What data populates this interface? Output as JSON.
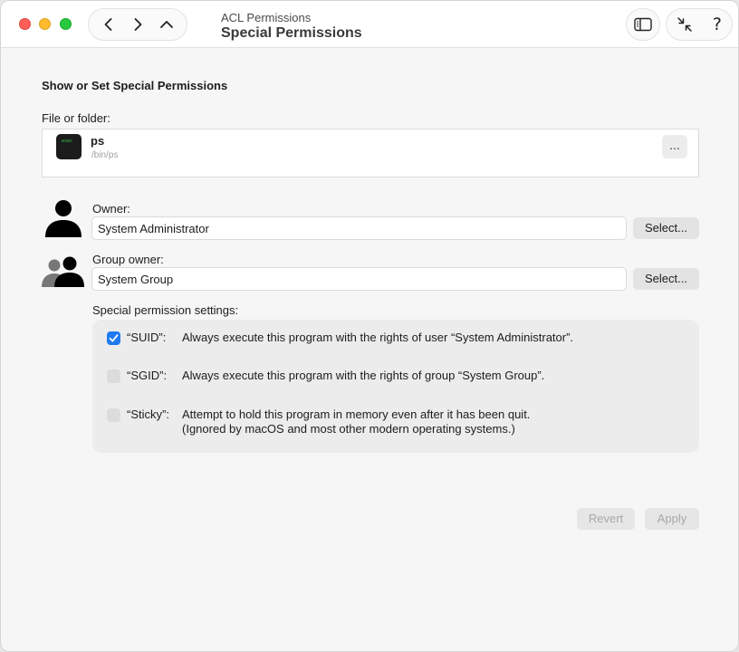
{
  "window": {
    "subtitle": "ACL Permissions",
    "title": "Special Permissions"
  },
  "toolbar": {
    "back_icon": "chevron-left-icon",
    "forward_icon": "chevron-right-icon",
    "up_icon": "chevron-up-icon",
    "sidebar_icon": "sidebar-icon",
    "collapse_icon": "arrows-collapse-icon",
    "help_label": "?"
  },
  "main": {
    "heading": "Show or Set Special Permissions",
    "file_label": "File or folder:",
    "file": {
      "name": "ps",
      "path": "/bin/ps",
      "icon_text": "exec",
      "more_label": "..."
    },
    "owner": {
      "label": "Owner:",
      "value": "System Administrator",
      "select_label": "Select..."
    },
    "group": {
      "label": "Group owner:",
      "value": "System Group",
      "select_label": "Select..."
    },
    "special_label": "Special permission settings:",
    "permissions": [
      {
        "name": "“SUID”:",
        "checked": true,
        "description": "Always execute this program with the rights of user “System Administrator”."
      },
      {
        "name": "“SGID”:",
        "checked": false,
        "description": "Always execute this program with the rights of group “System Group”."
      },
      {
        "name": "“Sticky”:",
        "checked": false,
        "description": "Attempt to hold this program in memory even after it has been quit.",
        "description_line2": "(Ignored by macOS and most other modern operating systems.)"
      }
    ],
    "revert_label": "Revert",
    "apply_label": "Apply"
  },
  "colors": {
    "accent": "#1f7aef",
    "close": "#fe5f57",
    "minimize": "#febc2e",
    "zoom": "#28c840"
  }
}
